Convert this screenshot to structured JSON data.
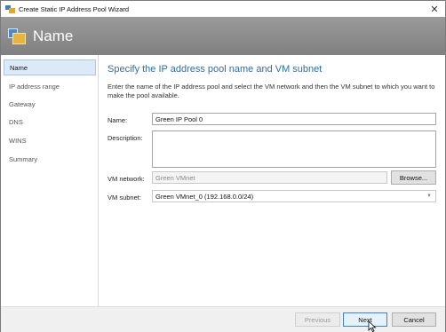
{
  "window": {
    "title": "Create Static IP Address Pool Wizard",
    "close_glyph": "✕"
  },
  "banner": {
    "title": "Name",
    "icon": "ip-pool-wizard-icon"
  },
  "sidebar": {
    "items": [
      {
        "label": "Name",
        "active": true
      },
      {
        "label": "IP address range"
      },
      {
        "label": "Gateway"
      },
      {
        "label": "DNS"
      },
      {
        "label": "WINS"
      },
      {
        "label": "Summary"
      }
    ]
  },
  "main": {
    "heading": "Specify the IP address pool name and VM subnet",
    "description": "Enter the name of the IP address pool and select the VM network and then the VM subnet to which you want to make the pool available.",
    "name_label": "Name:",
    "name_value": "Green IP Pool 0",
    "description_label": "Description:",
    "description_value": "",
    "vm_network_label": "VM network:",
    "vm_network_value": "Green VMnet",
    "browse_label": "Browse...",
    "vm_subnet_label": "VM subnet:",
    "vm_subnet_value": "Green VMnet_0 (192.168.0.0/24)"
  },
  "footer": {
    "previous_label": "Previous",
    "next_label": "Next",
    "cancel_label": "Cancel"
  },
  "colors": {
    "heading": "#2f6ea8",
    "banner": "#8c8c8c",
    "active_nav": "#dceaf7"
  }
}
